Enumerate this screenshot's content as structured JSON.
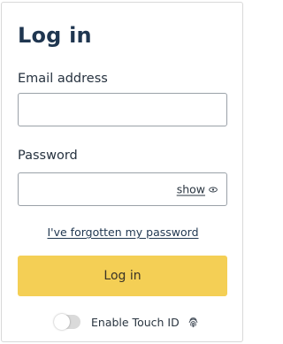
{
  "login": {
    "title": "Log in",
    "email_label": "Email address",
    "email_value": "",
    "email_placeholder": "",
    "password_label": "Password",
    "password_value": "",
    "password_placeholder": "",
    "show_label": "show",
    "show_icon": "eye-icon",
    "forgot_link": "I've forgotten my password",
    "submit_label": "Log in",
    "touch_id_label": "Enable Touch ID",
    "touch_id_enabled": false,
    "touch_id_icon": "fingerprint-icon"
  },
  "colors": {
    "button": "#f4cf55",
    "title": "#1f3650",
    "field_border": "#9aa1a8",
    "toggle_off": "#dadada"
  }
}
